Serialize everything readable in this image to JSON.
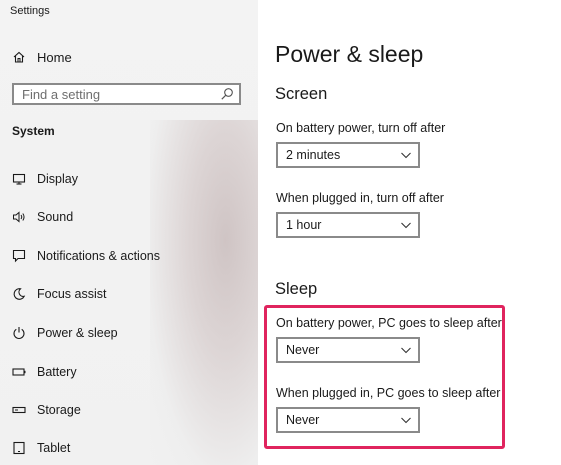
{
  "window": {
    "title": "Settings"
  },
  "sidebar": {
    "home_label": "Home",
    "search_placeholder": "Find a setting",
    "section_label": "System",
    "items": [
      {
        "label": "Display",
        "icon": "display-icon"
      },
      {
        "label": "Sound",
        "icon": "sound-icon"
      },
      {
        "label": "Notifications & actions",
        "icon": "notifications-icon"
      },
      {
        "label": "Focus assist",
        "icon": "moon-icon"
      },
      {
        "label": "Power & sleep",
        "icon": "power-icon"
      },
      {
        "label": "Battery",
        "icon": "battery-icon"
      },
      {
        "label": "Storage",
        "icon": "storage-icon"
      },
      {
        "label": "Tablet",
        "icon": "tablet-icon"
      }
    ]
  },
  "main": {
    "title": "Power & sleep",
    "screen": {
      "heading": "Screen",
      "battery_label": "On battery power, turn off after",
      "battery_value": "2 minutes",
      "plugged_label": "When plugged in, turn off after",
      "plugged_value": "1 hour"
    },
    "sleep": {
      "heading": "Sleep",
      "battery_label": "On battery power, PC goes to sleep after",
      "battery_value": "Never",
      "plugged_label": "When plugged in, PC goes to sleep after",
      "plugged_value": "Never"
    }
  },
  "colors": {
    "highlight": "#e0245e",
    "sidebar_bg": "#f3f3f3"
  }
}
